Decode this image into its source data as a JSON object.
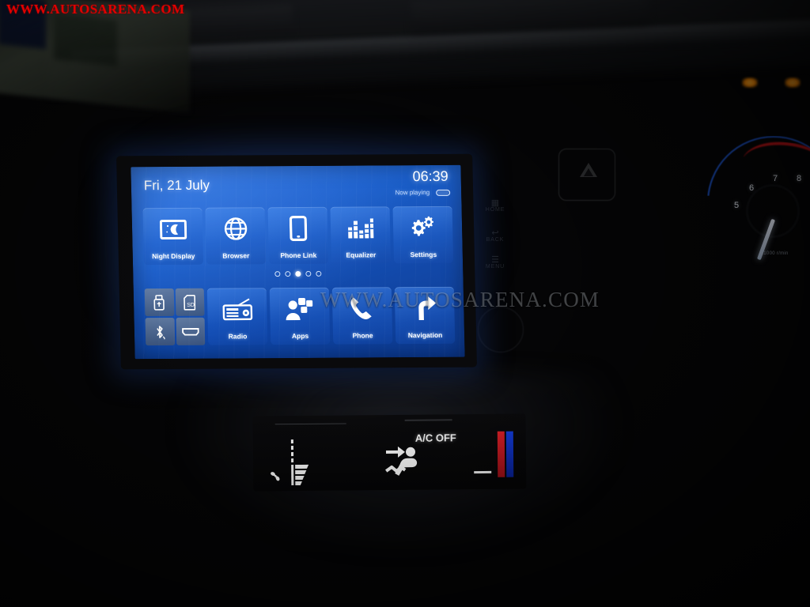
{
  "watermark": {
    "top_left": "WWW.AUTOSARENA.COM",
    "center": "WWW.AUTOSARENA.COM",
    "color": "#e00000"
  },
  "head_unit": {
    "status_bar": {
      "date": "Fri, 21 July",
      "clock": "06:39",
      "now_playing_label": "Now playing",
      "now_playing_icon": "media-chip-icon"
    },
    "screen_accent": "#1461d8",
    "tiles_top": [
      {
        "label": "Night Display",
        "icon": "night-display-icon"
      },
      {
        "label": "Browser",
        "icon": "globe-icon"
      },
      {
        "label": "Phone Link",
        "icon": "smartphone-icon"
      },
      {
        "label": "Equalizer",
        "icon": "equalizer-bars-icon"
      },
      {
        "label": "Settings",
        "icon": "gears-icon"
      }
    ],
    "tiles_bottom": [
      {
        "label": "Radio",
        "icon": "radio-icon"
      },
      {
        "label": "Apps",
        "icon": "apps-people-icon"
      },
      {
        "label": "Phone",
        "icon": "phone-handset-icon"
      },
      {
        "label": "Navigation",
        "icon": "navigation-arrow-icon"
      }
    ],
    "device_shortcuts": [
      {
        "name": "usb-drive-icon"
      },
      {
        "name": "sd-card-icon"
      },
      {
        "name": "bluetooth-icon"
      },
      {
        "name": "hdmi-port-icon"
      }
    ],
    "page_indicator": {
      "total": 5,
      "active": 3
    }
  },
  "climate_panel": {
    "ac_status": "A/C OFF",
    "fan_icon": "fan-blade-icon",
    "fan_level_bars": 4,
    "airflow_icon": "airflow-face-icon",
    "temperature_gauge": {
      "hot_color": "#e8222a",
      "cold_color": "#1540e8"
    }
  },
  "instrument_cluster": {
    "tachometer": {
      "ticks": [
        "5",
        "6",
        "7",
        "8"
      ],
      "unit": "x1000 r/min",
      "redline_start": "7"
    },
    "telltales": [
      {
        "name": "indicator-lamp-left",
        "color": "#ff8a00"
      },
      {
        "name": "indicator-lamp-right",
        "color": "#ff8a00"
      }
    ]
  },
  "console_buttons": [
    {
      "label": "HOME"
    },
    {
      "label": "BACK"
    },
    {
      "label": "MENU"
    }
  ]
}
